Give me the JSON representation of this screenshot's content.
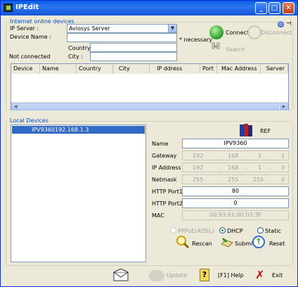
{
  "window": {
    "title": "IPEdit"
  },
  "online": {
    "group_title": "Internet online devices",
    "ip_server_label": "IP Server :",
    "ip_server_value": "Aviosys Server",
    "device_name_label": "Device Name :",
    "device_name_value": "",
    "necessary_label": "* necessary",
    "country_label": "Country :",
    "country_value": "",
    "city_label": "City :",
    "city_value": "",
    "status_text": "Not connected",
    "connect_label": "Connect",
    "disconnect_label": "Disconnect",
    "search_label": "Search",
    "columns": [
      "Device",
      "Name",
      "Country",
      "City",
      "IP ddress",
      "Port",
      "Mac Address",
      "Server"
    ]
  },
  "local": {
    "group_title": "Local Devices",
    "devices": [
      "IPV9360192.168.1.3"
    ],
    "ref_label": "REF",
    "name_label": "Name",
    "name_value": "IPV9360",
    "gateway_label": "Gateway",
    "gateway": [
      "192",
      "168",
      "1",
      "1"
    ],
    "ip_label": "IP Address",
    "ip": [
      "192",
      "168",
      "1",
      "3"
    ],
    "netmask_label": "Netmask",
    "netmask": [
      "255",
      "255",
      "255",
      "0"
    ],
    "http1_label": "HTTP Port1",
    "http1_value": "80",
    "http2_label": "HTTP Port2",
    "http2_value": "0",
    "mac_label": "MAC",
    "mac_value": "00:93:61:00:03:3F",
    "pppoe_label": "PPPoE(ADSL)",
    "dhcp_label": "DHCP",
    "static_label": "Static",
    "rescan_label": "Rescan",
    "submit_label": "Submit",
    "reset_label": "Reset"
  },
  "footer": {
    "update_label": "Update",
    "help_label": "[F1] Help",
    "exit_label": "Exit"
  }
}
